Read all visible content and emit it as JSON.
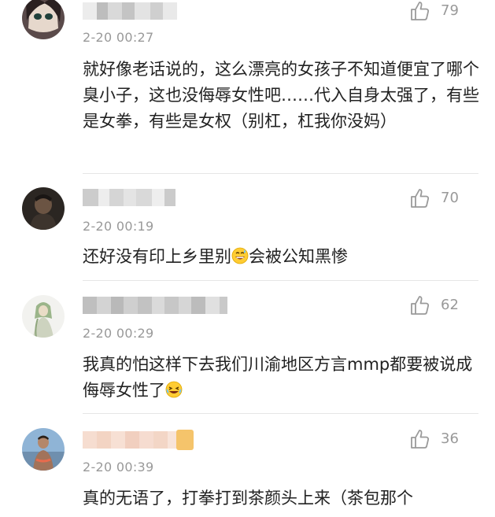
{
  "comments": [
    {
      "time": "2-20 00:27",
      "likes": "79",
      "text": "就好像老话说的，这么漂亮的女孩子不知道便宜了哪个臭小子，这也没侮辱女性吧……代入自身太强了，有些是女拳，有些是女权（别杠，杠我你没妈）",
      "like_icon": "thumbs-up-icon"
    },
    {
      "time": "2-20 00:19",
      "likes": "70",
      "text_before": "还好没有印上乡里别",
      "emoji": "grinning-sweat-emoji",
      "text_after": "会被公知黑惨",
      "like_icon": "thumbs-up-icon"
    },
    {
      "time": "2-20 00:29",
      "likes": "62",
      "text": "我真的怕这样下去我们川渝地区方言mmp都要被说成侮辱女性了",
      "emoji": "crying-laughing-emoji",
      "like_icon": "thumbs-up-icon"
    },
    {
      "time": "2-20 00:39",
      "likes": "36",
      "text": "真的无语了，打拳打到茶颜头上来（茶包那个",
      "like_icon": "thumbs-up-icon"
    }
  ],
  "colors": {
    "meta": "#999999",
    "text": "#222222",
    "divider": "#e6e6e6",
    "blur_name": "#c8c8c8"
  }
}
